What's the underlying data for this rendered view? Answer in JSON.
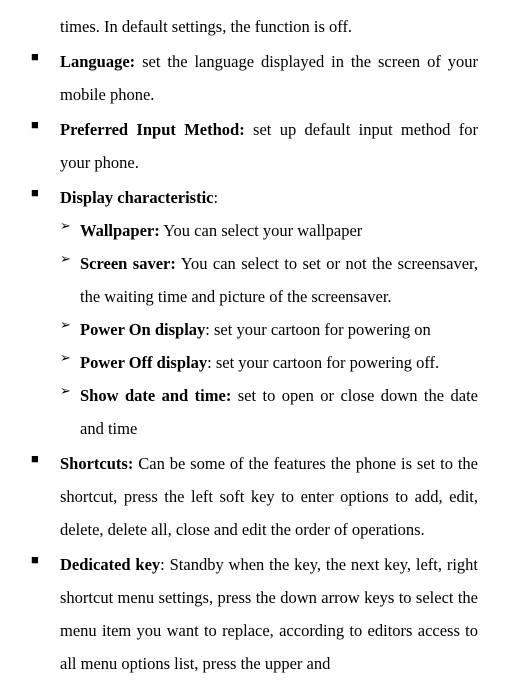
{
  "frag": "times. In default settings, the function is off.",
  "items": [
    {
      "label": "Language:",
      "text": " set the language displayed in the screen of your mobile phone."
    },
    {
      "label": "Preferred Input Method:",
      "text": " set up default input method for your phone."
    },
    {
      "label": "Display characteristic",
      "text": ":",
      "sub": [
        {
          "label": "Wallpaper:",
          "text": " You can select your wallpaper"
        },
        {
          "label": "Screen saver:",
          "text": " You can select to set or not the screensaver, the waiting time and picture of the screensaver."
        },
        {
          "label": "Power On display",
          "text": ": set your cartoon for powering on"
        },
        {
          "label": "Power Off display",
          "text": ": set your cartoon for powering off."
        },
        {
          "label": "Show date and time:",
          "text": " set to open or close down the date and time"
        }
      ]
    },
    {
      "label": "Shortcuts:",
      "text": " Can be some of the features the phone is set to the shortcut, press the left soft key to enter options to add, edit, delete, delete all, close and edit the order of operations."
    },
    {
      "label": "Dedicated key",
      "text": ": Standby when the key, the next key, left, right shortcut menu settings, press the down arrow keys to select the menu item you want to replace, according to editors access to all menu options list, press the upper and"
    }
  ]
}
